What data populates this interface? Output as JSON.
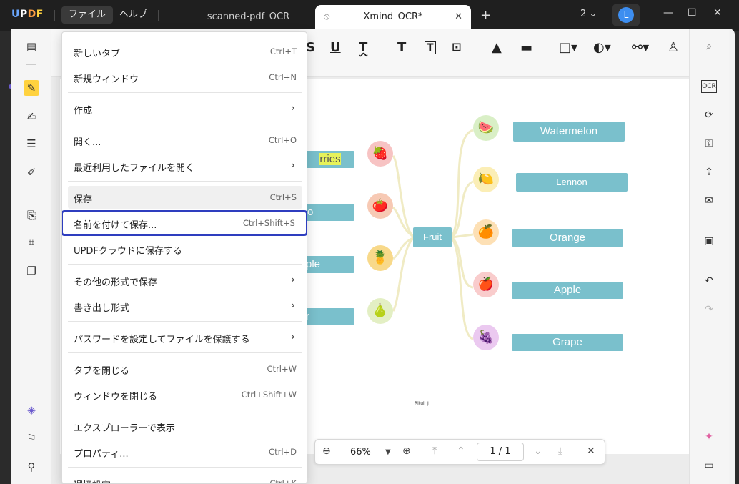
{
  "app": {
    "logo": [
      "U",
      "P",
      "D",
      "F"
    ]
  },
  "menubar": {
    "file": "ファイル",
    "help": "ヘルプ"
  },
  "tabs": [
    {
      "label": "scanned-pdf_OCR"
    },
    {
      "label": "Xmind_OCR*"
    }
  ],
  "titlebar": {
    "new_tab": "+",
    "page_count": "2",
    "avatar_letter": "L",
    "minimize": "—",
    "maximize": "☐",
    "close": "✕"
  },
  "file_menu": [
    {
      "label": "新しいタブ",
      "shortcut": "Ctrl+T"
    },
    {
      "label": "新規ウィンドウ",
      "shortcut": "Ctrl+N"
    },
    {
      "label": "作成",
      "submenu": true
    },
    {
      "label": "開く...",
      "shortcut": "Ctrl+O"
    },
    {
      "label": "最近利用したファイルを開く",
      "submenu": true
    },
    {
      "label": "保存",
      "shortcut": "Ctrl+S"
    },
    {
      "label": "名前を付けて保存...",
      "shortcut": "Ctrl+Shift+S"
    },
    {
      "label": "UPDFクラウドに保存する"
    },
    {
      "label": "その他の形式で保存",
      "submenu": true
    },
    {
      "label": "書き出し形式",
      "submenu": true
    },
    {
      "label": "パスワードを設定してファイルを保護する",
      "submenu": true
    },
    {
      "label": "タブを閉じる",
      "shortcut": "Ctrl+W"
    },
    {
      "label": "ウィンドウを閉じる",
      "shortcut": "Ctrl+Shift+W"
    },
    {
      "label": "エクスプローラーで表示"
    },
    {
      "label": "プロパティ...",
      "shortcut": "Ctrl+D"
    },
    {
      "label": "環境設定",
      "shortcut": "Ctrl+K"
    }
  ],
  "mindmap": {
    "center": "Fruit",
    "right_nodes": [
      "Watermelon",
      "Lennon",
      "Orange",
      "Apple",
      "Grape"
    ],
    "left_nodes_partial": [
      "rries",
      "o",
      "ple",
      "r"
    ],
    "footer": "Rituir J"
  },
  "zoombar": {
    "zoom": "66%",
    "page_current": "1",
    "page_sep": "/",
    "page_total": "1"
  },
  "colors": {
    "accent": "#2e3dbf",
    "node": "#7ac0cc",
    "highlight": "#ffd23f",
    "avatar": "#3d8ef0"
  }
}
